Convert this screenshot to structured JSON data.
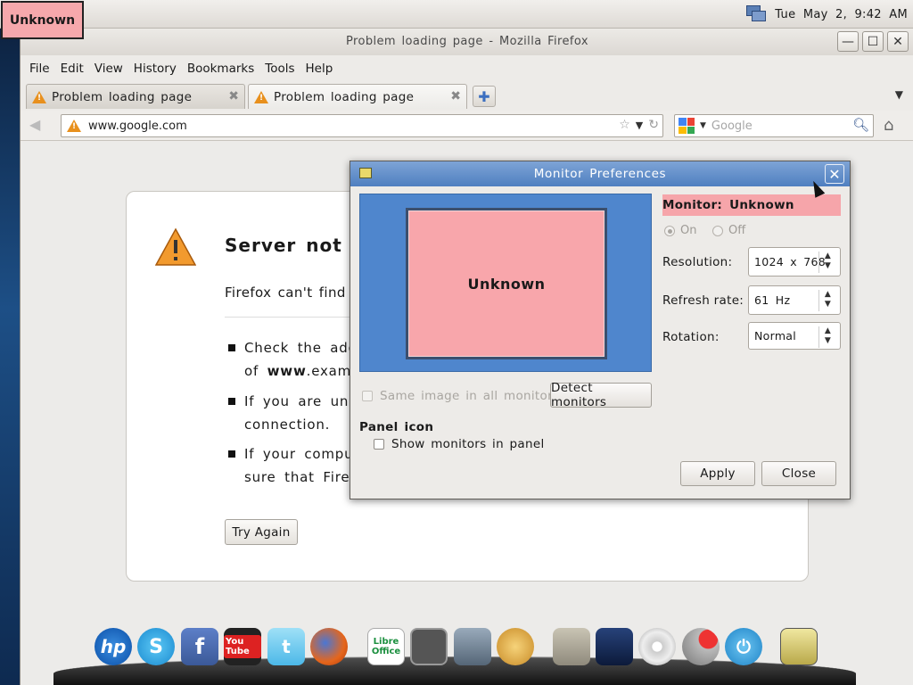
{
  "top_panel": {
    "unknown_label": "Unknown",
    "clock": "Tue May 2,  9:42 AM"
  },
  "firefox": {
    "window_title": "Problem loading page - Mozilla Firefox",
    "menu": [
      "File",
      "Edit",
      "View",
      "History",
      "Bookmarks",
      "Tools",
      "Help"
    ],
    "tabs": [
      {
        "label": "Problem loading page"
      },
      {
        "label": "Problem loading page"
      }
    ],
    "url": "www.google.com",
    "search_placeholder": "Google",
    "error": {
      "title": "Server not",
      "subtitle": "Firefox can't find",
      "bullets": [
        {
          "line1": "Check the addre",
          "line2_prefix": "of ",
          "line2_bold": "www",
          "line2_rest": ".examp"
        },
        {
          "line1": "If you are unab",
          "line2": "connection."
        },
        {
          "line1": "If your compute",
          "line2": "sure that Firefo"
        }
      ],
      "try_again_label": "Try Again"
    }
  },
  "monitor_prefs": {
    "title": "Monitor Preferences",
    "screen_label": "Unknown",
    "monitor_label": "Monitor:  Unknown",
    "on_label": "On",
    "off_label": "Off",
    "resolution_label": "Resolution:",
    "resolution_value": "1024 x 768",
    "refresh_label": "Refresh rate:",
    "refresh_value": "61 Hz",
    "rotation_label": "Rotation:",
    "rotation_value": "Normal",
    "same_image_label": "Same image in all monitors",
    "detect_label": "Detect monitors",
    "panel_icon_heading": "Panel icon",
    "show_in_panel_label": "Show monitors in panel",
    "apply_label": "Apply",
    "close_label": "Close"
  },
  "dock": {
    "icons": [
      "hp",
      "skype",
      "facebook",
      "youtube",
      "twitter",
      "firefox",
      "libreoffice",
      "terminal",
      "calculator",
      "paint",
      "files",
      "workspace",
      "disc",
      "volume",
      "power",
      "monitor-preferences"
    ],
    "labels": {
      "hp": "hp",
      "facebook": "f",
      "youtube": "You Tube",
      "libreoffice": "Libre Office"
    }
  },
  "colors": {
    "unknown_pink": "#f6a8ac",
    "dialog_title_blue": "#5a88c6",
    "monitor_canvas_blue": "#4f86cd",
    "warning_orange": "#e8901d"
  }
}
